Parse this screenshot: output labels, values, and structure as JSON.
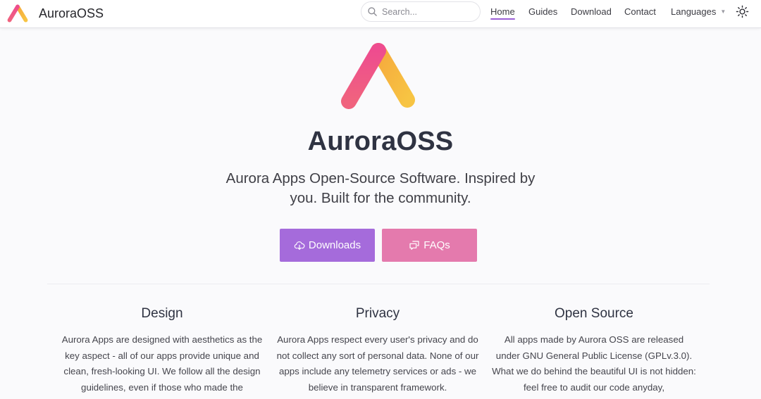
{
  "header": {
    "brand_name": "AuroraOSS",
    "search": {
      "placeholder": "Search...",
      "value": ""
    },
    "nav": [
      {
        "label": "Home",
        "active": true
      },
      {
        "label": "Guides",
        "active": false
      },
      {
        "label": "Download",
        "active": false
      },
      {
        "label": "Contact",
        "active": false
      },
      {
        "label": "Languages",
        "active": false,
        "has_dropdown": true
      }
    ],
    "icons": {
      "search": "search-icon",
      "theme": "sun-icon",
      "dropdown": "caret-down-icon"
    }
  },
  "hero": {
    "title": "AuroraOSS",
    "tagline": "Aurora Apps Open-Source Software. Inspired by you. Built for the community.",
    "buttons": {
      "downloads_label": "Downloads",
      "faqs_label": "FAQs",
      "downloads_icon": "cloud-download-icon",
      "faqs_icon": "chat-bubbles-icon"
    }
  },
  "features": [
    {
      "title": "Design",
      "text": "Aurora Apps are designed with aesthetics as the key aspect - all of our apps provide unique and clean, fresh-looking UI. We follow all the design guidelines, even if those who made the"
    },
    {
      "title": "Privacy",
      "text": "Aurora Apps respect every user's privacy and do not collect any sort of personal data. None of our apps include any telemetry services or ads - we believe in transparent framework."
    },
    {
      "title": "Open Source",
      "text": "All apps made by Aurora OSS are released under GNU General Public License (GPLv.3.0). What we do behind the beautiful UI is not hidden: feel free to audit our code anyday,"
    }
  ],
  "colors": {
    "accent": "#9b5fd6",
    "downloads_button": "#a56bdb",
    "faqs_button": "#e47aad",
    "logo_pink": "#ee4c8f",
    "logo_yellow": "#f5b93d",
    "logo_blue": "#5aa6f0"
  }
}
